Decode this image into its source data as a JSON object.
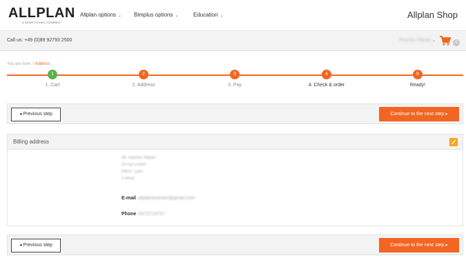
{
  "header": {
    "logo_text": "ALLPLAN",
    "logo_tagline": "A NEMETSCHEK COMPANY",
    "nav": [
      {
        "label": "Allplan options"
      },
      {
        "label": "Bimplus options"
      },
      {
        "label": "Education"
      }
    ],
    "shop_title": "Allplan Shop"
  },
  "callbar": {
    "call_text": "Call us: +49 (0)89 92793 2500",
    "user_name": "Teacher Allplan",
    "cart_count": "0"
  },
  "breadcrumb": {
    "prefix": "You are here:",
    "separator": "/",
    "current": "Address"
  },
  "steps": [
    {
      "number": "1",
      "label": "1. Cart",
      "state": "done"
    },
    {
      "number": "2",
      "label": "2. Address",
      "state": "current"
    },
    {
      "number": "3",
      "label": "3. Pay",
      "state": "pending"
    },
    {
      "number": "4",
      "label": "4. Check & order",
      "state": "pending"
    },
    {
      "number": "5",
      "label": "Ready!",
      "state": "pending"
    }
  ],
  "buttons": {
    "prev": "◂ Previous step",
    "next": "Continue to the next step ▸"
  },
  "billing": {
    "title": "Billing address",
    "lines": [
      "Mr Teacher Allplan",
      "20 rue Lorem",
      "69007 Lyon",
      "France"
    ],
    "email_label": "E-mail",
    "email_value": "allplanteacher@gmail.com",
    "phone_label": "Phone",
    "phone_value": "0472714757"
  },
  "colors": {
    "accent": "#f26522",
    "done": "#5ab14a",
    "edit": "#f6a623"
  }
}
